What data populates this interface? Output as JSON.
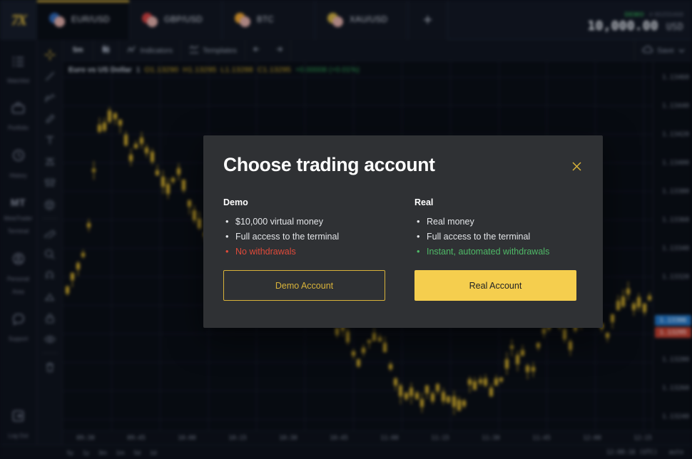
{
  "app": {
    "logo": "7X",
    "tabs": [
      {
        "label": "EUR/USD",
        "active": true,
        "color": "#2a5fa8"
      },
      {
        "label": "GBP/USD",
        "active": false,
        "color": "#c33a3a"
      },
      {
        "label": "BTC",
        "active": false,
        "color": "#e09a2a"
      },
      {
        "label": "XAU/USD",
        "active": false,
        "color": "#c2a33a"
      }
    ],
    "add_tab_label": "+",
    "balance": {
      "type": "DEMO",
      "account": "# 80255468",
      "amount": "10,000.00",
      "currency": "USD"
    }
  },
  "sidebar": {
    "items": [
      {
        "label": "Watchlist",
        "icon": "list-icon"
      },
      {
        "label": "Portfolio",
        "icon": "briefcase-icon"
      },
      {
        "label": "History",
        "icon": "clock-icon"
      },
      {
        "label": "MetaTrader Terminal",
        "icon": "mt-icon",
        "badge": "MT"
      },
      {
        "label": "Personal Area",
        "icon": "user-circle-icon"
      },
      {
        "label": "Support",
        "icon": "chat-icon"
      }
    ],
    "logout": {
      "label": "Log Out",
      "icon": "logout-icon"
    }
  },
  "tools": [
    "crosshair-icon",
    "trendline-icon",
    "pattern-icon",
    "brush-icon",
    "text-icon",
    "fib-icon",
    "measure-icon",
    "emoji-icon",
    "ruler-icon",
    "zoom-icon",
    "magnet-icon",
    "scale-icon",
    "lock-icon",
    "eye-icon",
    "trash-icon"
  ],
  "chart_toolbar": {
    "timeframe": "5m",
    "chart_type_icon": "candlestick-icon",
    "indicators": "Indicators",
    "templates": "Templates",
    "undo_icon": "undo-icon",
    "redo_icon": "redo-icon",
    "save": "Save",
    "save_icon": "cloud-icon",
    "save_caret": "chevron-down-icon"
  },
  "chart": {
    "legend": {
      "symbol": "Euro vs US Dollar",
      "interval": "1",
      "open": "O1.13290",
      "high": "H1.13295",
      "low": "L1.13288",
      "close": "C1.13295",
      "change": "+0.00008 (+0.01%)"
    },
    "price_labels": [
      "1.13460",
      "1.13440",
      "1.13420",
      "1.13400",
      "1.13380",
      "1.13360",
      "1.13340",
      "1.13320",
      "1.13280",
      "1.13260",
      "1.13240"
    ],
    "bid_badge": "1.13306",
    "ask_badge": "1.13295",
    "time_labels": [
      "09:30",
      "09:45",
      "10:00",
      "10:15",
      "10:30",
      "10:45",
      "11:00",
      "11:15",
      "11:30",
      "11:45",
      "12:00",
      "12:15"
    ],
    "ranges": [
      "5y",
      "1y",
      "3m",
      "1m",
      "5d",
      "1d"
    ],
    "clock": "12:08:16 (UTC)",
    "autoscale": "auto"
  },
  "modal": {
    "title": "Choose trading account",
    "close_icon": "close-icon",
    "columns": [
      {
        "title": "Demo",
        "features": [
          {
            "text": "$10,000 virtual money",
            "tone": "neutral"
          },
          {
            "text": "Full access to the terminal",
            "tone": "neutral"
          },
          {
            "text": "No withdrawals",
            "tone": "negative"
          }
        ],
        "button": {
          "label": "Demo Account",
          "style": "outline"
        }
      },
      {
        "title": "Real",
        "features": [
          {
            "text": "Real money",
            "tone": "neutral"
          },
          {
            "text": "Full access to the terminal",
            "tone": "neutral"
          },
          {
            "text": "Instant, automated withdrawals",
            "tone": "positive"
          }
        ],
        "button": {
          "label": "Real Account",
          "style": "solid"
        }
      }
    ]
  },
  "colors": {
    "accent_yellow": "#f5ce4e",
    "outline_yellow": "#d9b33a",
    "negative_red": "#e04a3a",
    "positive_green": "#4fb967",
    "bid_blue": "#1f6bb5",
    "ask_red": "#b2392a",
    "modal_bg": "#2f3134",
    "chart_bg": "#080b12"
  }
}
